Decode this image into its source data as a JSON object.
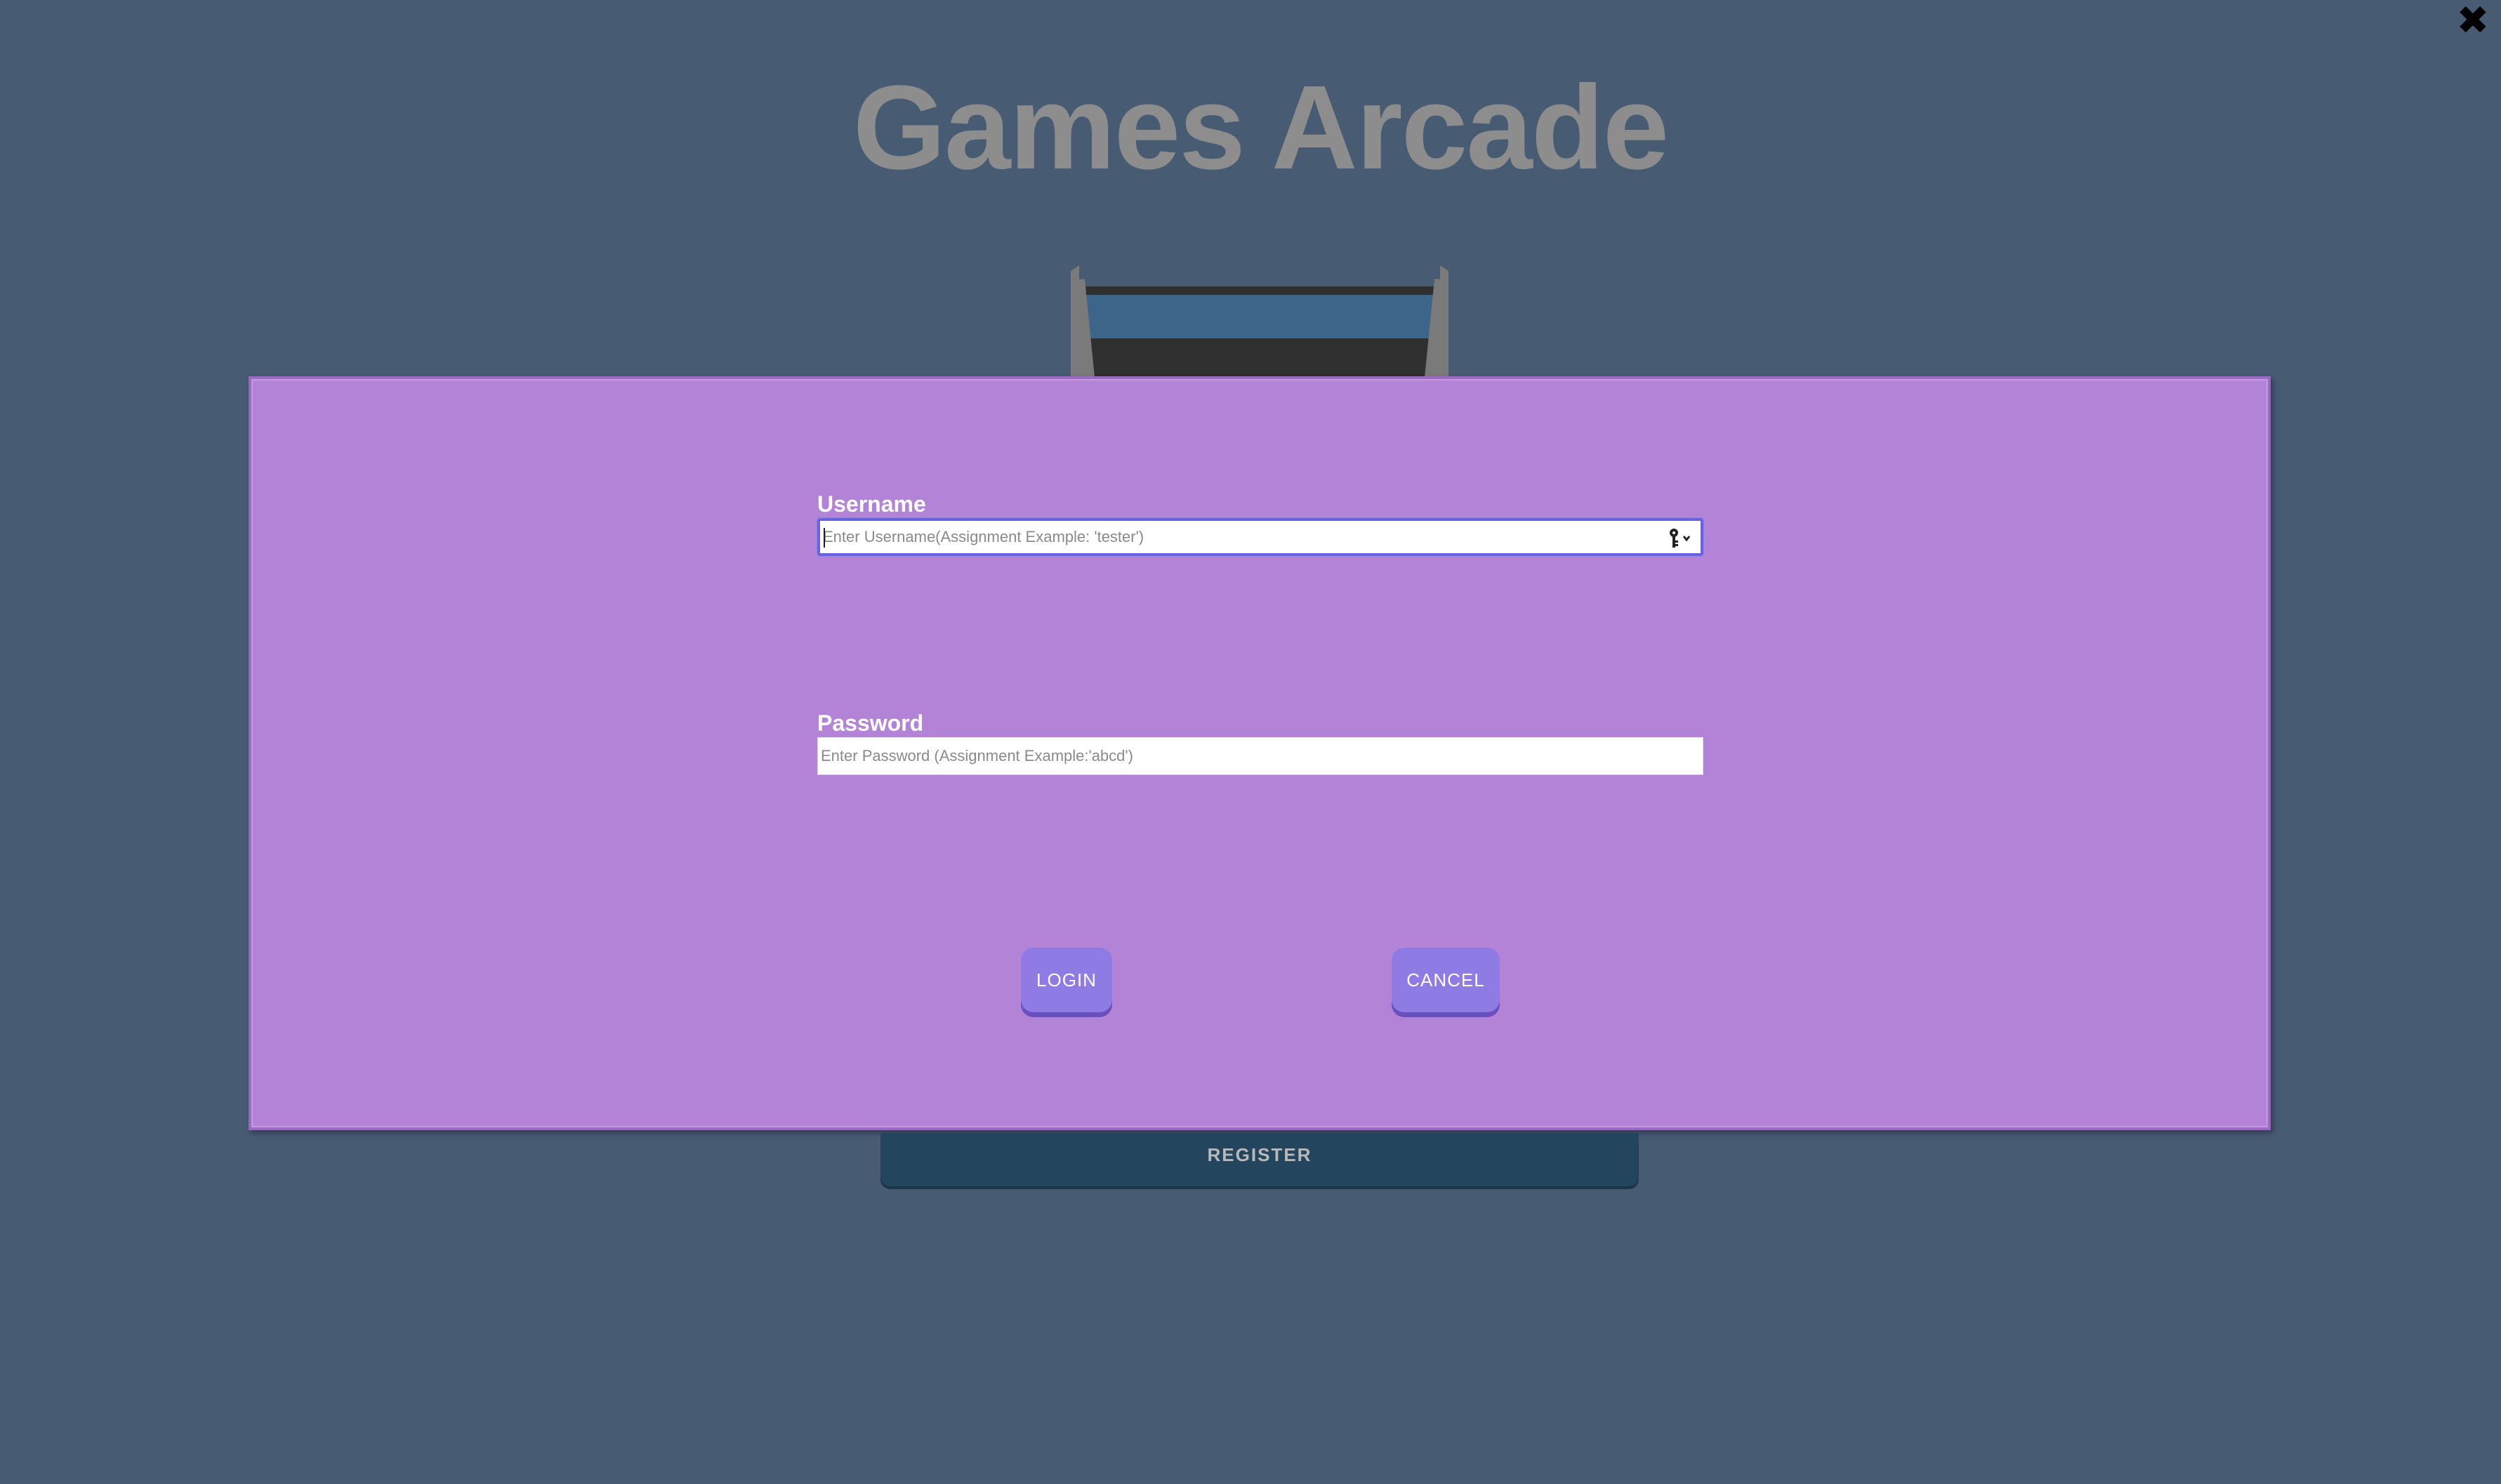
{
  "app": {
    "title": "Games Arcade"
  },
  "window": {
    "close_icon": "close-icon"
  },
  "login_form": {
    "username_label": "Username",
    "username_placeholder": "Enter Username(Assignment Example: 'tester')",
    "username_value": "",
    "password_label": "Password",
    "password_placeholder": "Enter Password (Assignment Example:'abcd')",
    "password_value": "",
    "autofill_icon": "key-icon",
    "login_label": "LOGIN",
    "cancel_label": "CANCEL"
  },
  "register": {
    "label": "REGISTER"
  },
  "colors": {
    "background": "#475b72",
    "modal": "#b383d8",
    "button": "#8e7ce4",
    "register_bar": "#23455d",
    "title": "#8d8d8d"
  }
}
